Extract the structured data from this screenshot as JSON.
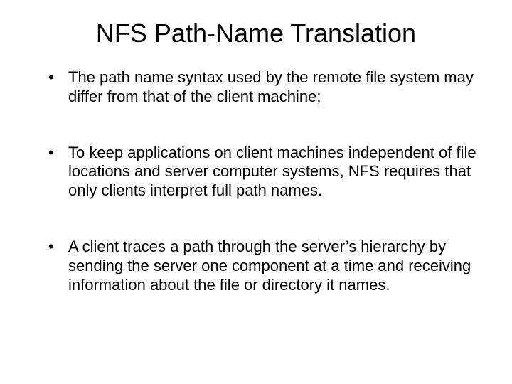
{
  "title": "NFS Path-Name Translation",
  "bullets": [
    "The path name syntax used by the remote file system may differ from that of the client machine;",
    "To keep applications on client machines independent of file locations and server computer systems, NFS requires that only clients interpret full path names.",
    "A client traces a path through the server’s hierarchy by sending the server one component at a time and receiving information about the file or directory it names."
  ]
}
